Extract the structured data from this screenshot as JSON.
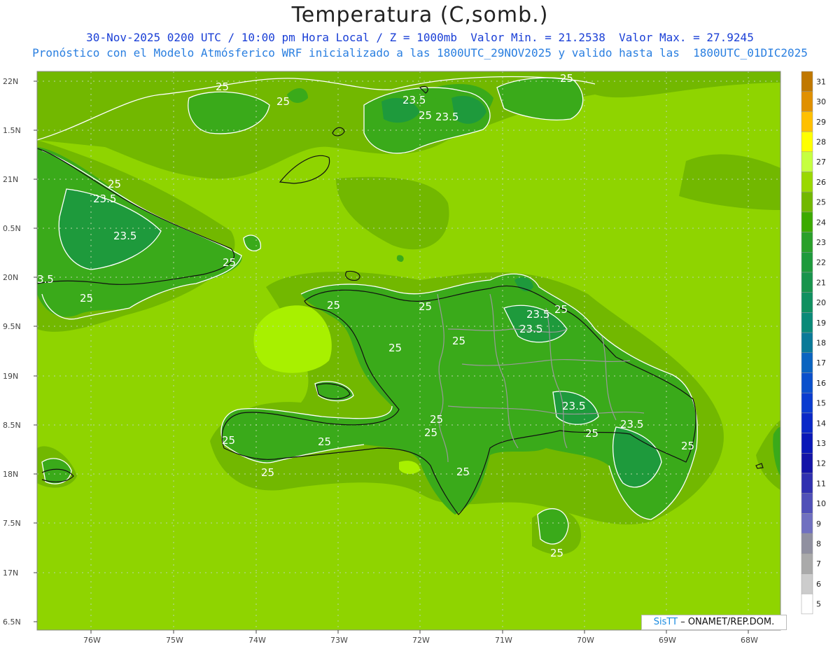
{
  "header": {
    "title": "Temperatura (C,somb.)",
    "line1": "30-Nov-2025 0200 UTC / 10:00 pm Hora Local / Z = 1000mb  Valor Min. = 21.2538  Valor Max. = 27.9245",
    "line2": "Pronóstico con el Modelo Atmósferico WRF inicializado a las 1800UTC_29NOV2025 y valido hasta las  1800UTC_01DIC2025"
  },
  "axes": {
    "lat_labels": [
      "22N",
      "1.5N",
      "21N",
      "0.5N",
      "20N",
      "9.5N",
      "19N",
      "8.5N",
      "18N",
      "7.5N",
      "17N",
      "6.5N"
    ],
    "lon_labels": [
      "76W",
      "75W",
      "74W",
      "73W",
      "72W",
      "71W",
      "70W",
      "69W",
      "68W"
    ]
  },
  "contour_labels": [
    "25",
    "25",
    "25",
    "23.5",
    "25",
    "23.5",
    "25",
    "23.5",
    "25",
    "25",
    "23.5",
    "25",
    "25",
    "25",
    "3.5",
    "25",
    "23.5",
    "23.5",
    "25",
    "25",
    "25",
    "25",
    "25",
    "23.5",
    "25",
    "23.5",
    "25",
    "25",
    "25",
    "25"
  ],
  "colorbar": {
    "labels": [
      "31",
      "30",
      "29",
      "28",
      "27",
      "26",
      "25",
      "24",
      "23",
      "22",
      "21",
      "20",
      "19",
      "18",
      "17",
      "16",
      "15",
      "14",
      "13",
      "12",
      "11",
      "10",
      "9",
      "8",
      "7",
      "6",
      "5"
    ],
    "colors": [
      "#c07800",
      "#e09000",
      "#ffc000",
      "#ffff00",
      "#c6ff40",
      "#9ad800",
      "#72b800",
      "#3caa00",
      "#2aa02a",
      "#1e9a3c",
      "#18944c",
      "#109060",
      "#0a8a78",
      "#0a7a98",
      "#0a64c0",
      "#0a50cc",
      "#0a3cd0",
      "#0a28c8",
      "#0a18b8",
      "#1414a8",
      "#3030b0",
      "#5050b8",
      "#7070c0",
      "#9090a0",
      "#aaaaaa",
      "#cccccc",
      "#ffffff"
    ]
  },
  "palette": {
    "ocean": "#8fd400",
    "warm": "#a8f000",
    "land": "#3aaa1a",
    "coast_shade": "#6cb800",
    "cool": "#1e9a3c",
    "contour": "#ffffff",
    "coast": "#111111",
    "border": "#9a9a9a"
  },
  "credit": {
    "brand": "SisTT",
    "text": " – ONAMET/REP.DOM."
  }
}
